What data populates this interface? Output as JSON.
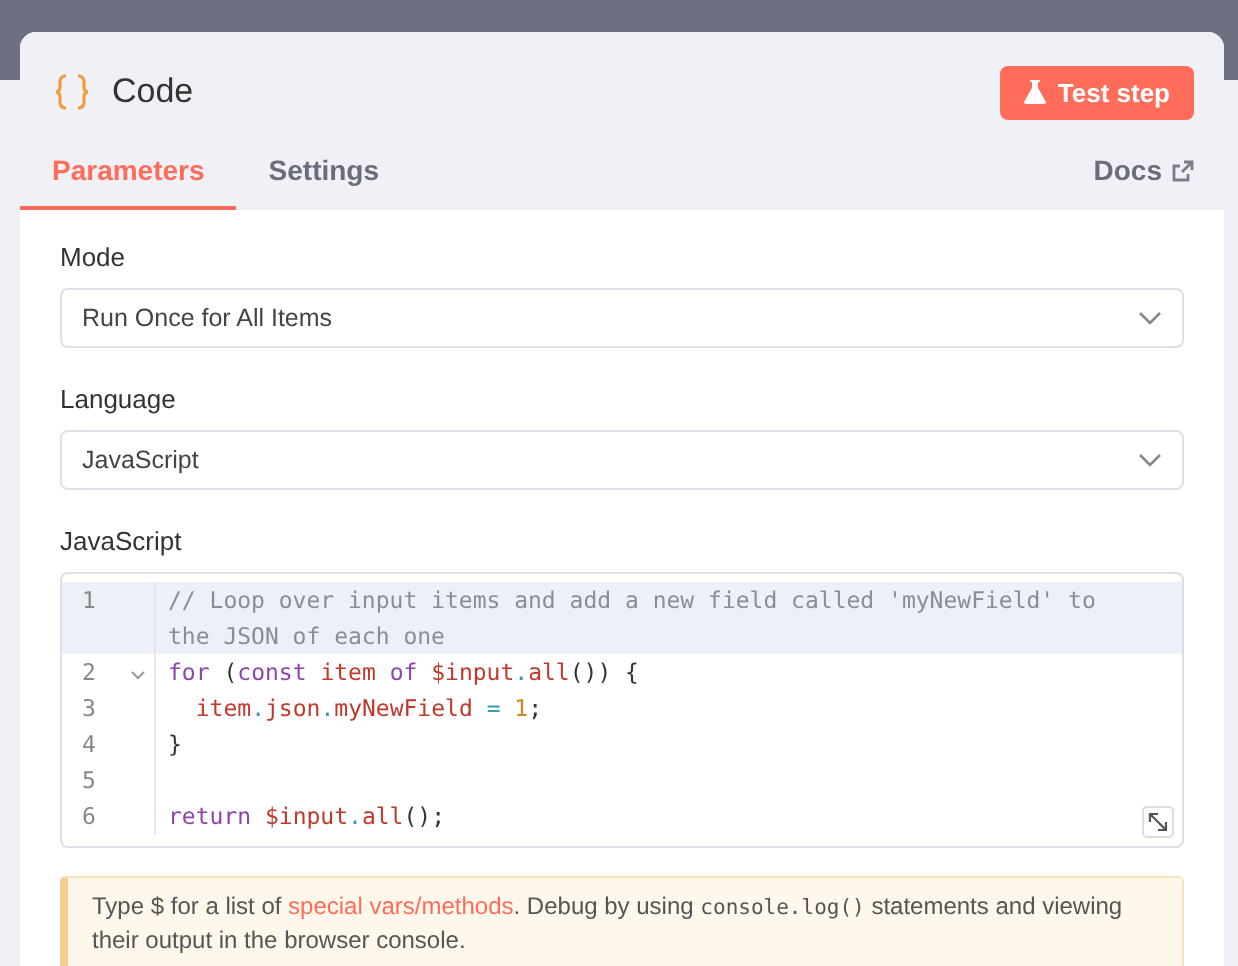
{
  "node": {
    "title": "Code",
    "test_button": "Test step"
  },
  "tabs": [
    {
      "label": "Parameters",
      "selected": true
    },
    {
      "label": "Settings",
      "selected": false
    }
  ],
  "docs_link": "Docs",
  "fields": [
    {
      "label": "Mode",
      "value": "Run Once for All Items"
    },
    {
      "label": "Language",
      "value": "JavaScript"
    }
  ],
  "editor": {
    "label": "JavaScript",
    "lines": [
      {
        "number": "1",
        "active": true,
        "foldable": false,
        "tokens": [
          {
            "text": "// Loop over input items and add a new field called 'myNewField' to the JSON of each one",
            "kind": "comment"
          }
        ]
      },
      {
        "number": "2",
        "active": false,
        "foldable": true,
        "tokens": [
          {
            "text": "for",
            "kind": "keyword"
          },
          {
            "text": " (",
            "kind": "punct"
          },
          {
            "text": "const",
            "kind": "keyword"
          },
          {
            "text": " item",
            "kind": "var"
          },
          {
            "text": " of",
            "kind": "keyword"
          },
          {
            "text": " $input",
            "kind": "var"
          },
          {
            "text": ".",
            "kind": "op"
          },
          {
            "text": "all",
            "kind": "var"
          },
          {
            "text": "()) {",
            "kind": "punct"
          }
        ]
      },
      {
        "number": "3",
        "active": false,
        "foldable": false,
        "tokens": [
          {
            "text": "  item",
            "kind": "var"
          },
          {
            "text": ".",
            "kind": "op"
          },
          {
            "text": "json",
            "kind": "var"
          },
          {
            "text": ".",
            "kind": "op"
          },
          {
            "text": "myNewField",
            "kind": "var"
          },
          {
            "text": " = ",
            "kind": "op"
          },
          {
            "text": "1",
            "kind": "number"
          },
          {
            "text": ";",
            "kind": "punct"
          }
        ]
      },
      {
        "number": "4",
        "active": false,
        "foldable": false,
        "tokens": [
          {
            "text": "}",
            "kind": "punct"
          }
        ]
      },
      {
        "number": "5",
        "active": false,
        "foldable": false
      },
      {
        "number": "6",
        "active": false,
        "foldable": false,
        "tokens": [
          {
            "text": "return",
            "kind": "keyword"
          },
          {
            "text": " $input",
            "kind": "var"
          },
          {
            "text": ".",
            "kind": "op"
          },
          {
            "text": "all",
            "kind": "var"
          },
          {
            "text": "();",
            "kind": "punct"
          }
        ]
      }
    ]
  },
  "hint": [
    {
      "text": "Type $ for a list of ",
      "kind": "plain"
    },
    {
      "text": "special vars/methods",
      "kind": "link"
    },
    {
      "text": ". Debug by using ",
      "kind": "plain"
    },
    {
      "text": "console.log()",
      "kind": "code"
    },
    {
      "text": " statements and viewing their output in the browser console.",
      "kind": "plain"
    }
  ]
}
